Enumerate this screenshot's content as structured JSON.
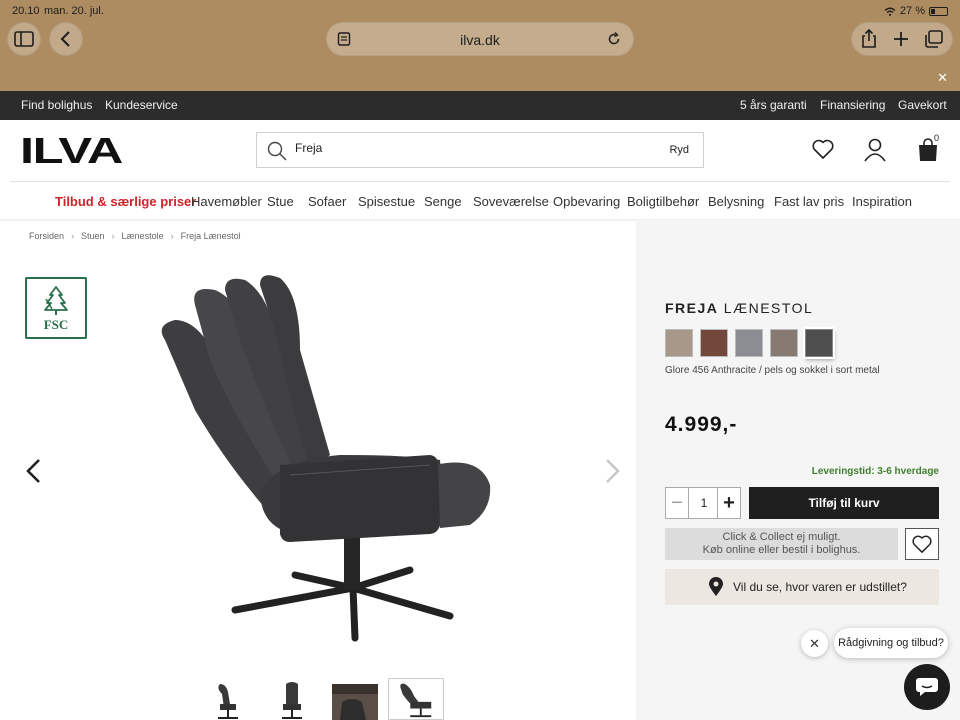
{
  "browser": {
    "time": "20.10",
    "date": "man. 20. jul.",
    "battery": "27 %",
    "url": "ilva.dk"
  },
  "topbar": {
    "left": [
      "Find bolighus",
      "Kundeservice"
    ],
    "right": [
      "5 års garanti",
      "Finansiering",
      "Gavekort"
    ]
  },
  "header": {
    "logo": "ILVA",
    "search_value": "Freja",
    "search_clear": "Ryd",
    "cart_count": "0"
  },
  "nav": {
    "items": [
      "Tilbud & særlige priser",
      "Havemøbler",
      "Stue",
      "Sofaer",
      "Spisestue",
      "Senge",
      "Soveværelse",
      "Opbevaring",
      "Boligtilbehør",
      "Belysning",
      "Fast lav pris",
      "Inspiration"
    ]
  },
  "breadcrumb": [
    "Forsiden",
    "Stuen",
    "Lænestole",
    "Freja Lænestol"
  ],
  "gallery": {
    "badge": "FSC"
  },
  "product": {
    "name": "FREJA",
    "type": "LÆNESTOL",
    "swatches": [
      "#a7988a",
      "#73473a",
      "#8c8d92",
      "#877a72",
      "#4e4e4e"
    ],
    "variant": "Glore 456 Anthracite / pels og sokkel i sort metal",
    "price": "4.999,-",
    "delivery": "Leveringstid: 3-6 hverdage",
    "quantity": "1",
    "add_to_cart": "Tilføj til kurv",
    "collect_line1": "Click & Collect ej muligt.",
    "collect_line2": "Køb online eller bestil i bolighus.",
    "showroom": "Vil du se, hvor varen er udstillet?"
  },
  "chat": {
    "bubble": "Rådgivning og tilbud?"
  }
}
